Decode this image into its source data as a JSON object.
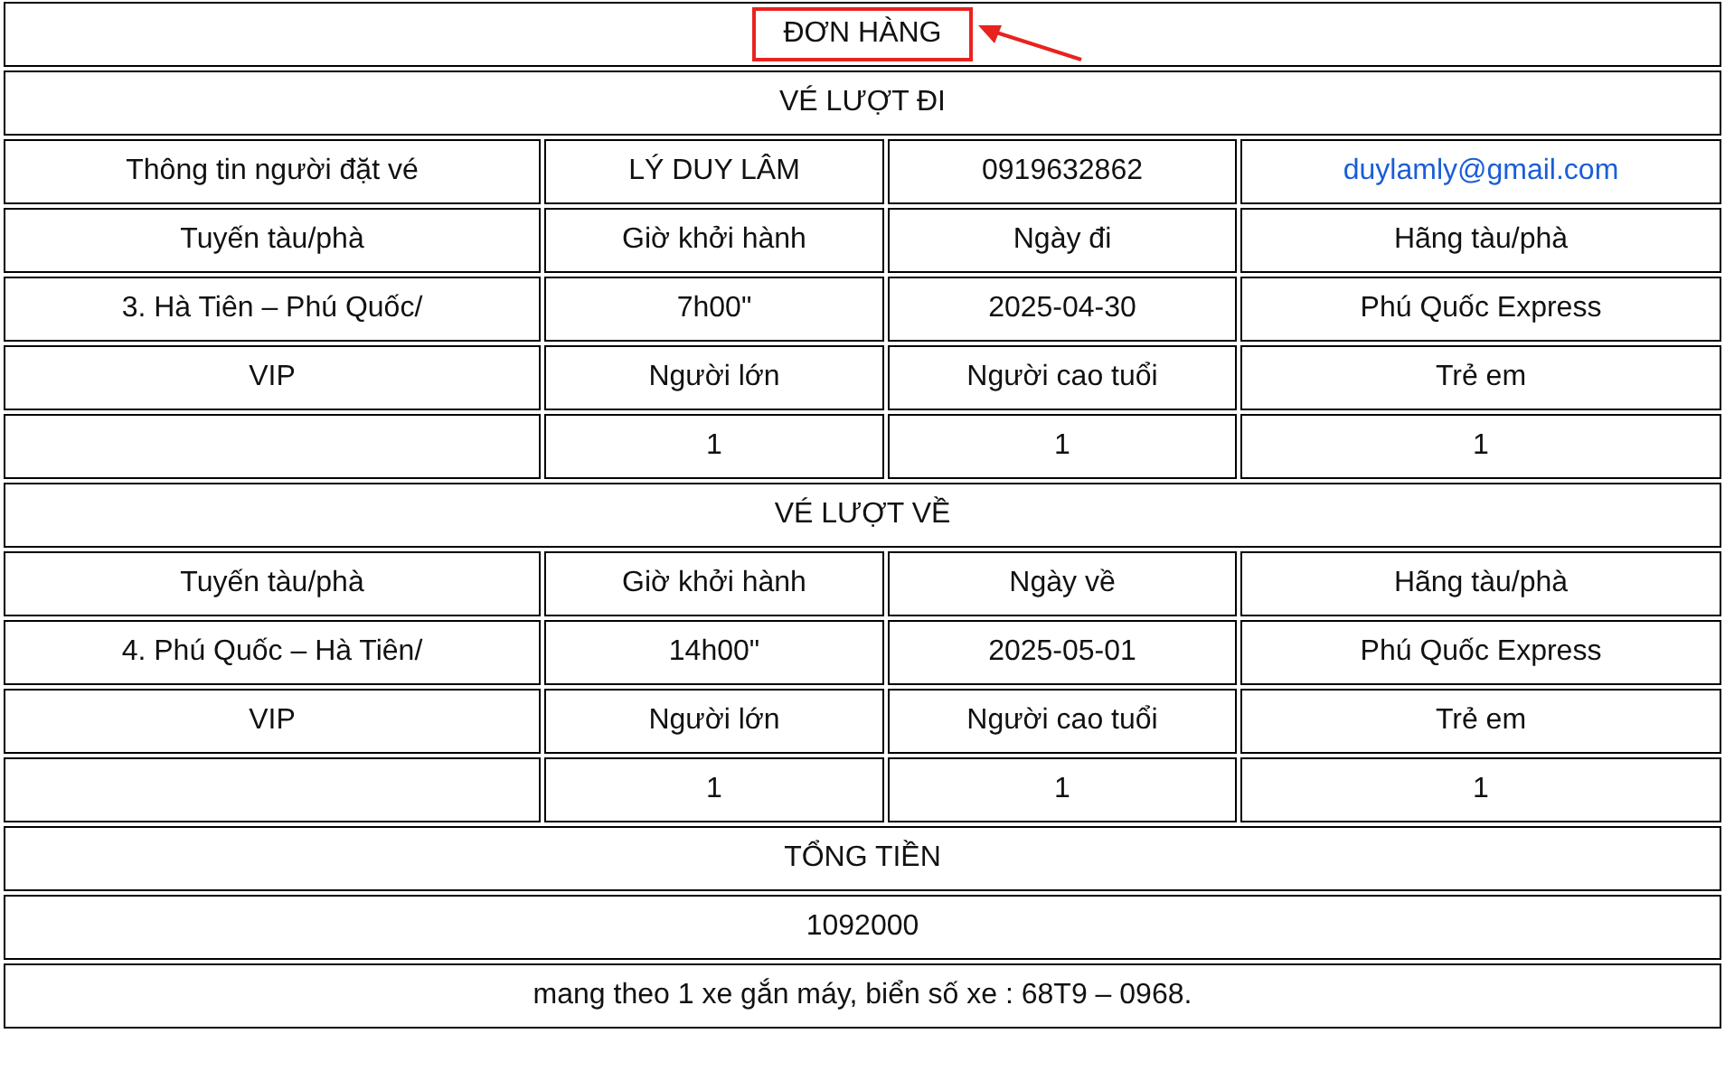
{
  "title": {
    "text": "ĐƠN HÀNG",
    "highlighted": true
  },
  "rows": [
    {
      "kind": "heading",
      "text": "VÉ LƯỢT ĐI"
    },
    {
      "kind": "cells",
      "cells": [
        {
          "kind": "text",
          "text": "Thông tin người đặt vé"
        },
        {
          "kind": "text",
          "text": "LÝ DUY LÂM"
        },
        {
          "kind": "text",
          "text": "0919632862"
        },
        {
          "kind": "link",
          "text": "duylamly@gmail.com"
        }
      ]
    },
    {
      "kind": "cells",
      "cells": [
        {
          "kind": "text",
          "text": "Tuyến tàu/phà"
        },
        {
          "kind": "text",
          "text": "Giờ khởi hành"
        },
        {
          "kind": "text",
          "text": "Ngày đi"
        },
        {
          "kind": "text",
          "text": "Hãng tàu/phà"
        }
      ]
    },
    {
      "kind": "cells",
      "cells": [
        {
          "kind": "text",
          "text": "3. Hà Tiên – Phú Quốc/"
        },
        {
          "kind": "text",
          "text": "7h00\""
        },
        {
          "kind": "text",
          "text": "2025-04-30"
        },
        {
          "kind": "text",
          "text": "Phú Quốc Express"
        }
      ]
    },
    {
      "kind": "cells",
      "cells": [
        {
          "kind": "text",
          "text": "VIP"
        },
        {
          "kind": "text",
          "text": "Người lớn"
        },
        {
          "kind": "text",
          "text": "Người cao tuổi"
        },
        {
          "kind": "text",
          "text": "Trẻ em"
        }
      ]
    },
    {
      "kind": "cells",
      "cells": [
        {
          "kind": "empty"
        },
        {
          "kind": "text",
          "text": "1"
        },
        {
          "kind": "text",
          "text": "1"
        },
        {
          "kind": "text",
          "text": "1"
        }
      ]
    },
    {
      "kind": "heading",
      "text": "VÉ LƯỢT VỀ"
    },
    {
      "kind": "cells",
      "cells": [
        {
          "kind": "text",
          "text": "Tuyến tàu/phà"
        },
        {
          "kind": "text",
          "text": "Giờ khởi hành"
        },
        {
          "kind": "text",
          "text": "Ngày về"
        },
        {
          "kind": "text",
          "text": "Hãng tàu/phà"
        }
      ]
    },
    {
      "kind": "cells",
      "cells": [
        {
          "kind": "text",
          "text": "4. Phú Quốc – Hà Tiên/"
        },
        {
          "kind": "text",
          "text": "14h00\""
        },
        {
          "kind": "text",
          "text": "2025-05-01"
        },
        {
          "kind": "text",
          "text": "Phú Quốc Express"
        }
      ]
    },
    {
      "kind": "cells",
      "cells": [
        {
          "kind": "text",
          "text": "VIP"
        },
        {
          "kind": "text",
          "text": "Người lớn"
        },
        {
          "kind": "text",
          "text": "Người cao tuổi"
        },
        {
          "kind": "text",
          "text": "Trẻ em"
        }
      ]
    },
    {
      "kind": "cells",
      "cells": [
        {
          "kind": "empty"
        },
        {
          "kind": "text",
          "text": "1"
        },
        {
          "kind": "text",
          "text": "1"
        },
        {
          "kind": "text",
          "text": "1"
        }
      ]
    },
    {
      "kind": "heading",
      "text": "TỔNG TIỀN"
    },
    {
      "kind": "heading",
      "text": "1092000"
    },
    {
      "kind": "heading",
      "text": "mang theo 1 xe gắn máy, biển số xe : 68T9 – 0968."
    }
  ]
}
